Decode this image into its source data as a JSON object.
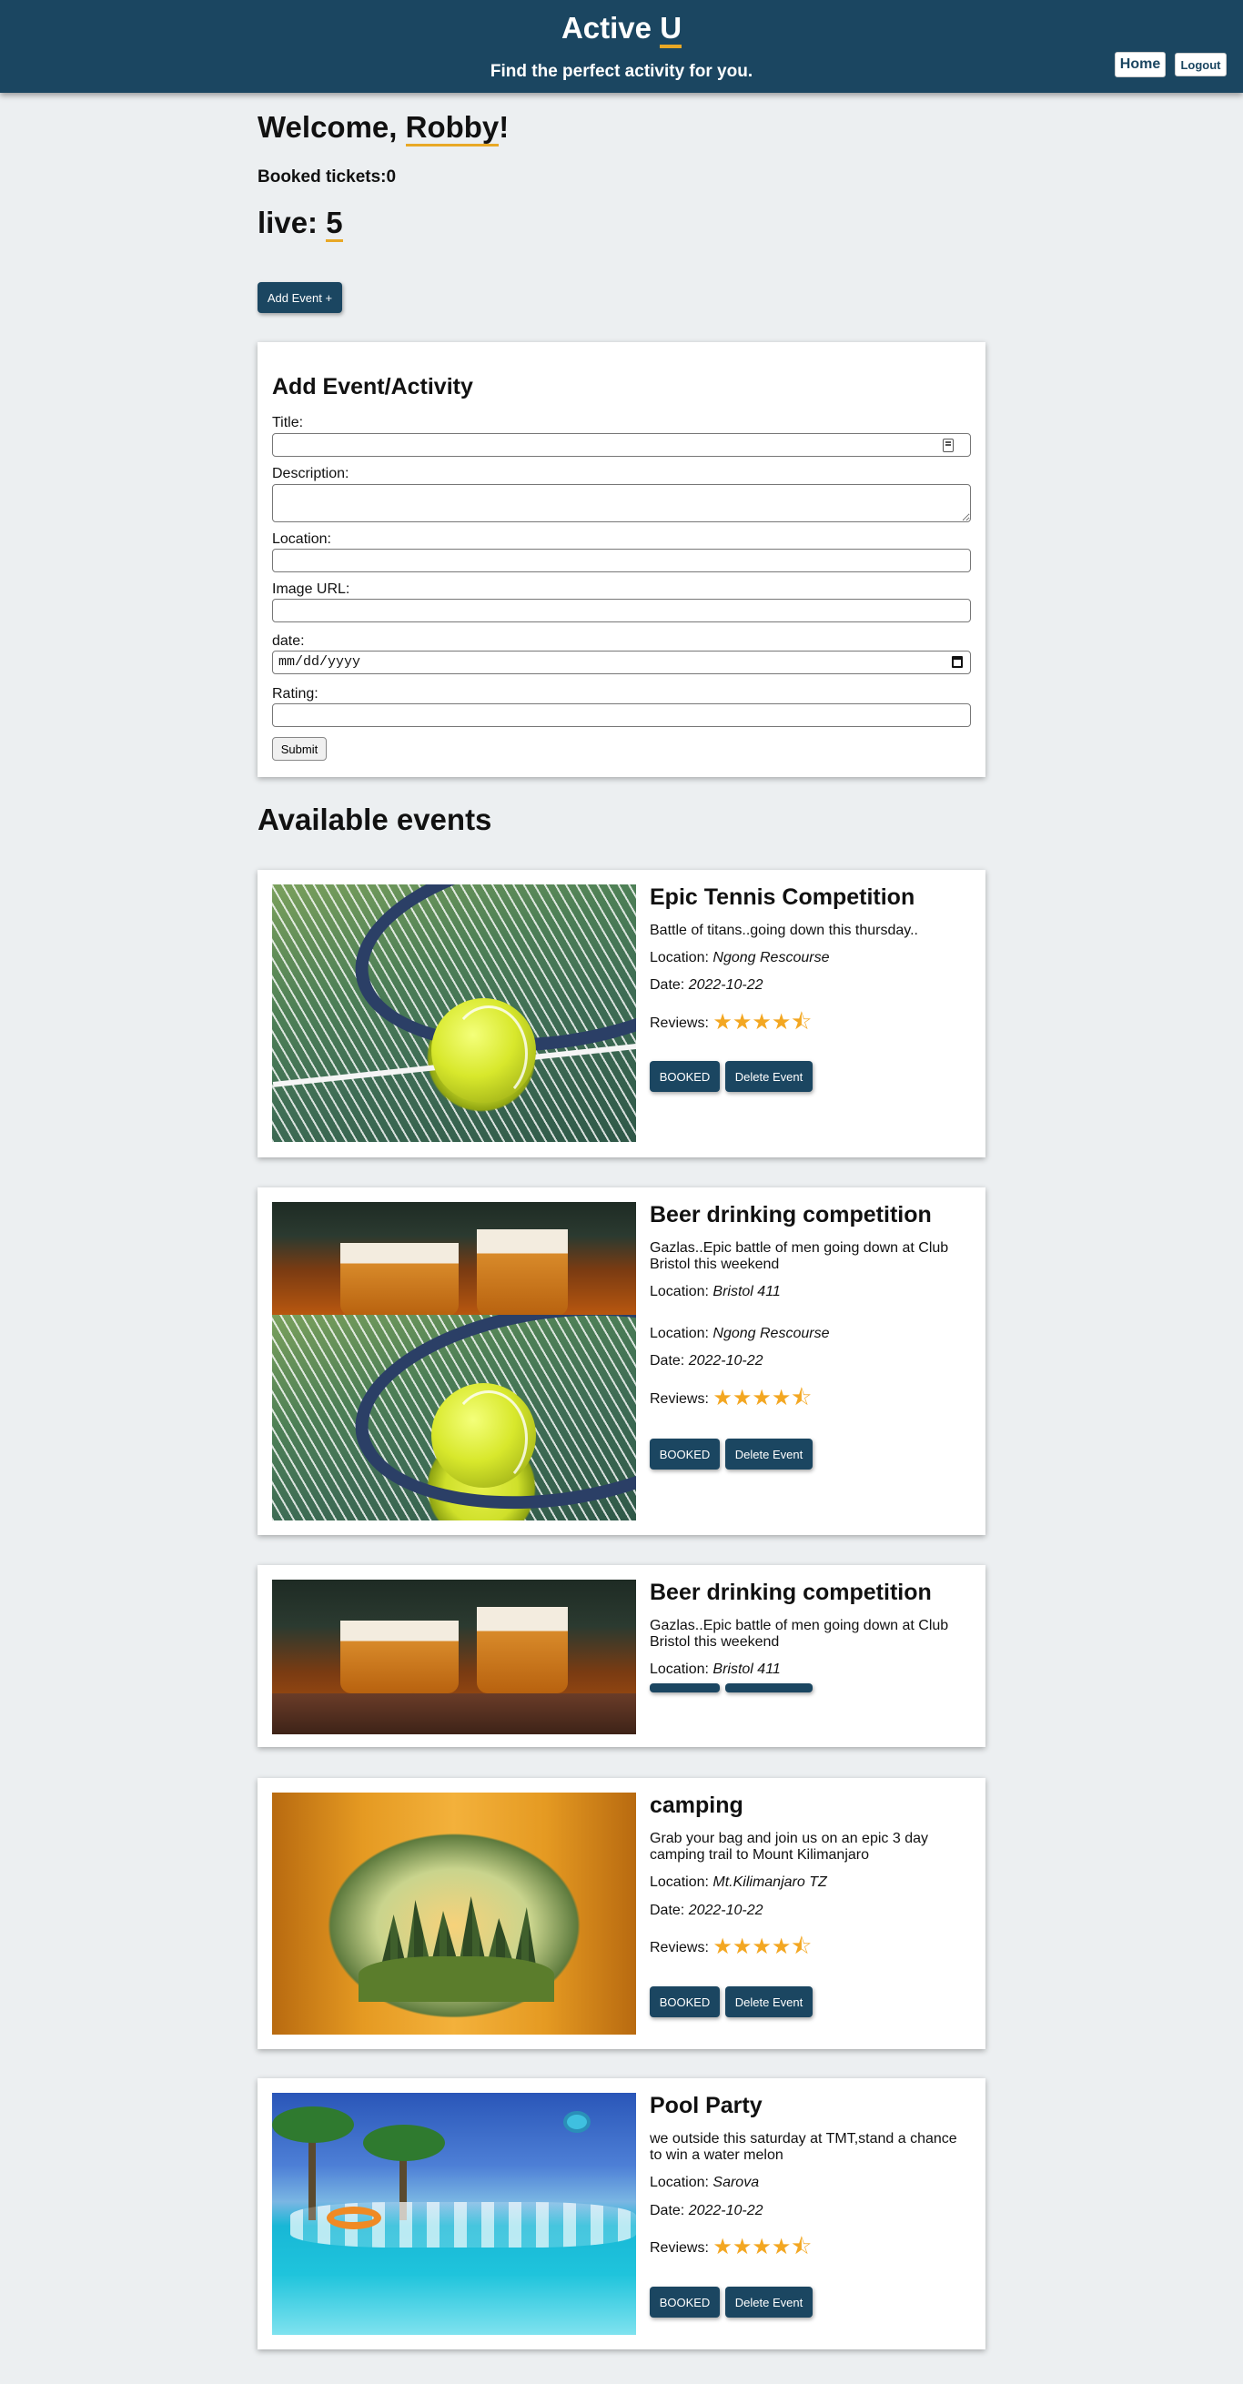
{
  "header": {
    "title_main": "Active ",
    "title_u": "U",
    "tagline": "Find the perfect activity for you.",
    "home_label": "Home",
    "logout_label": "Logout"
  },
  "dashboard": {
    "welcome_prefix": "Welcome, ",
    "user_name": "Robby",
    "welcome_suffix": "!",
    "booked_tickets": "Booked tickets:0",
    "live_prefix": "live: ",
    "live_count": "5",
    "add_event_label": "Add Event +"
  },
  "form": {
    "heading": "Add Event/Activity",
    "title_label": "Title:",
    "description_label": "Description:",
    "location_label": "Location:",
    "image_url_label": "Image URL:",
    "date_label": "date:",
    "date_placeholder": "mm/dd/yyyy",
    "rating_label": "Rating:",
    "submit_label": "Submit"
  },
  "events_heading": "Available events",
  "labels": {
    "location": "Location: ",
    "date": "Date: ",
    "reviews": "Reviews: ",
    "booked": "BOOKED",
    "delete": "Delete Event",
    "stars": "★★★★⯪"
  },
  "events": [
    {
      "title": "Epic Tennis Competition",
      "description": "Battle of titans..going down this thursday..",
      "location": "Ngong Rescourse",
      "date": "2022-10-22",
      "rating": 4.5,
      "image_icon": "tennis-image"
    },
    {
      "title": "Beer drinking competition",
      "description": "Gazlas..Epic battle of men going down at Club Bristol this weekend",
      "location": "Bristol 411",
      "overlap_location": "Ngong Rescourse",
      "overlap_date": "2022-10-22",
      "rating": 4.5,
      "image_icon": "beer-image"
    },
    {
      "title": "Beer drinking competition",
      "description": "Gazlas..Epic battle of men going down at Club Bristol this weekend",
      "location": "Bristol 411",
      "image_icon": "beer-image"
    },
    {
      "title": "camping",
      "description": "Grab your bag and join us on an epic 3 day camping trail to Mount Kilimanjaro",
      "location": "Mt.Kilimanjaro TZ",
      "date": "2022-10-22",
      "rating": 4.5,
      "image_icon": "camping-image"
    },
    {
      "title": "Pool Party",
      "description": "we outside this saturday at TMT,stand a chance to win a water melon",
      "location": "Sarova",
      "date": "2022-10-22",
      "rating": 4.5,
      "image_icon": "pool-image"
    }
  ],
  "colors": {
    "header": "#1b4661",
    "accent": "#e8a826",
    "stars": "#f3a722",
    "background": "#eceff1"
  }
}
